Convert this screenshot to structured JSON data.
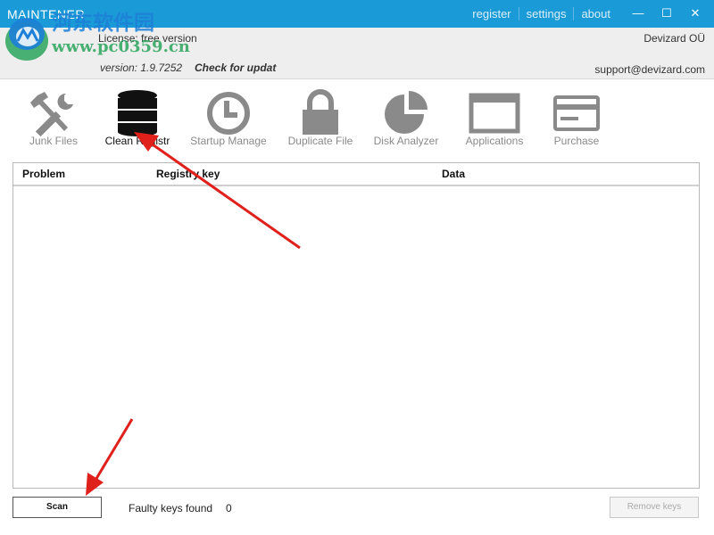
{
  "titlebar": {
    "title": "MAINTENER",
    "links": [
      "register",
      "settings",
      "about"
    ],
    "minimize_glyph": "—",
    "maximize_glyph": "☐",
    "close_glyph": "✕"
  },
  "header": {
    "license": "License: free version",
    "version": "version: 1.9.7252",
    "check_update": "Check for updat",
    "company": "Devizard OÜ",
    "support": "support@devizard.com"
  },
  "watermark": {
    "text1": "河东软件园",
    "text2": "www.pc0359.cn"
  },
  "toolbar": {
    "items": [
      {
        "label": "Junk Files",
        "icon": "tools-icon"
      },
      {
        "label": "Clean Registr",
        "icon": "database-icon"
      },
      {
        "label": "Startup Manage",
        "icon": "clock-icon"
      },
      {
        "label": "Duplicate File",
        "icon": "lock-icon"
      },
      {
        "label": "Disk Analyzer",
        "icon": "pie-chart-icon"
      },
      {
        "label": "Applications",
        "icon": "window-icon"
      },
      {
        "label": "Purchase",
        "icon": "credit-card-icon"
      }
    ],
    "active_index": 1
  },
  "table": {
    "columns": [
      "Problem",
      "Registry key",
      "Data"
    ],
    "rows": []
  },
  "footer": {
    "scan_label": "Scan",
    "faulty_label": "Faulty keys found",
    "faulty_count": "0",
    "remove_label": "Remove keys"
  },
  "colors": {
    "titlebar": "#1a9ad6",
    "header": "#eeeeee",
    "icon_gray": "#8a8a8a",
    "icon_active": "#111111",
    "annotation_arrow": "#e0201b"
  }
}
